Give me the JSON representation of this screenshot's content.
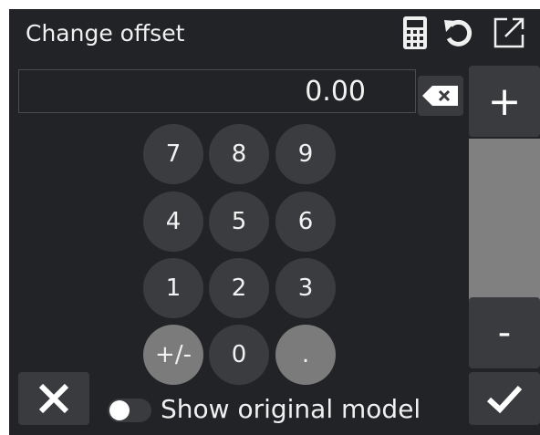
{
  "dialog": {
    "title": "Change offset",
    "icons": [
      "calculator-icon",
      "reset-icon",
      "expand-icon"
    ]
  },
  "display": {
    "value": "0.00"
  },
  "side_buttons": {
    "plus": "+",
    "minus": "-"
  },
  "keypad": {
    "keys": [
      "7",
      "8",
      "9",
      "4",
      "5",
      "6",
      "1",
      "2",
      "3",
      "+/-",
      "0",
      "."
    ]
  },
  "footer": {
    "toggle_label": "Show original model",
    "toggle_on": false
  },
  "colors": {
    "background": "#222326",
    "button": "#3a3b3e",
    "key": "#3b3c3f",
    "key_light": "#7b7b7b",
    "slider": "#808080",
    "text": "#f2f2f2"
  }
}
